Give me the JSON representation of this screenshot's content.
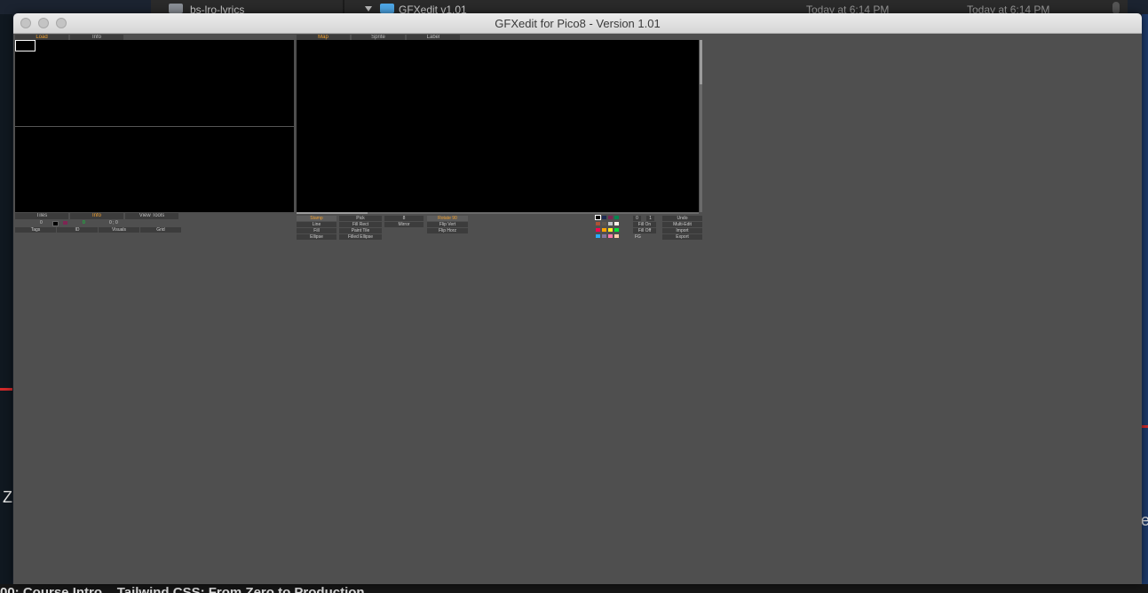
{
  "background": {
    "finder": {
      "folder1": "bs-lro-lyrics",
      "folder2": "GFXedit v1.01",
      "date_created": "Today at 6:14 PM",
      "date_modified": "Today at 6:14 PM"
    },
    "left_letter": "Z",
    "right_letter": "e",
    "bottom_text": "00: Course Intro    Tailwind CSS: From Zero to Production"
  },
  "window": {
    "title": "GFXedit for Pico8 - Version 1.01"
  },
  "left_panel": {
    "tabs": [
      "Load",
      "Info"
    ],
    "bottom_tabs": [
      "Tiles",
      "Info",
      "View Tools"
    ],
    "value_row": {
      "number": "0",
      "mid": "0",
      "right": "0 ; 0"
    },
    "buttons": [
      "Tags",
      "ID",
      "Visuals",
      "Grid"
    ]
  },
  "main_panel": {
    "tabs": [
      "Map",
      "Sprite",
      "Label"
    ],
    "tool_col1": [
      "Stamp",
      "Line",
      "Fill",
      "Ellipse"
    ],
    "tool_col2": [
      "Pick",
      "Fill Rect",
      "Paint Tile",
      "Filled Ellipse"
    ],
    "tool_col3": [
      "8",
      "Mirror"
    ],
    "tool_col4": [
      "Rotate 90",
      "Flip Vert",
      "Flip Horz"
    ],
    "palette_colors": [
      "#000000",
      "#1d2b53",
      "#7e2553",
      "#008751",
      "#ab5236",
      "#5f574f",
      "#c2c3c7",
      "#fff1e8",
      "#ff004d",
      "#ffa300",
      "#ffec27",
      "#00e436",
      "#29adff",
      "#83769c",
      "#ff77a8",
      "#ffccaa"
    ],
    "palette_side": [
      "0",
      "1",
      "Fill On",
      "Fill Off",
      "FG"
    ],
    "right_buttons": [
      "Undo",
      "Multi-Edit",
      "Import",
      "Export"
    ],
    "zoom_btns": [
      "-",
      "+"
    ]
  }
}
